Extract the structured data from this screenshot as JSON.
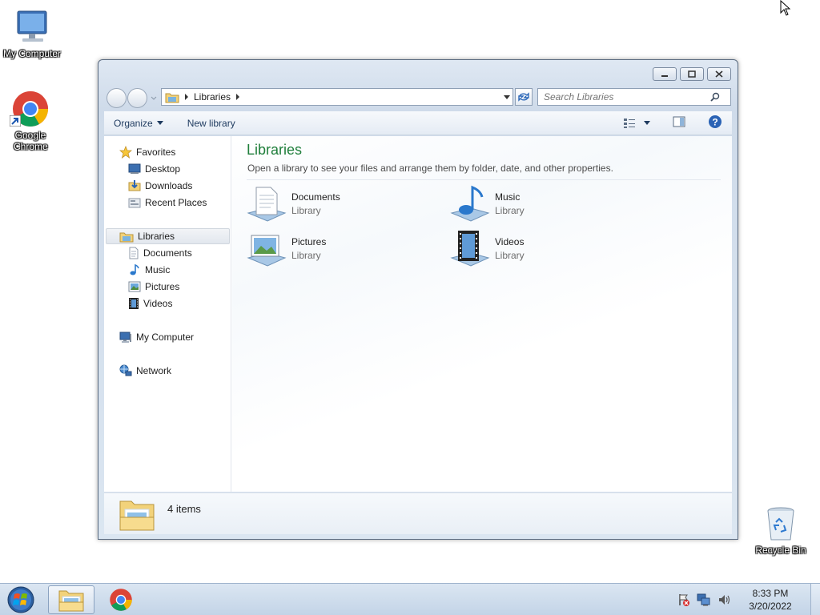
{
  "desktop": {
    "icons": [
      {
        "label": "My Computer"
      },
      {
        "label": "Google Chrome"
      },
      {
        "label": "Recycle Bin"
      }
    ]
  },
  "window": {
    "address": {
      "crumb": "Libraries"
    },
    "search": {
      "placeholder": "Search Libraries"
    },
    "toolbar": {
      "organize": "Organize",
      "new_library": "New library"
    },
    "nav": {
      "favorites": "Favorites",
      "desktop": "Desktop",
      "downloads": "Downloads",
      "recent_places": "Recent Places",
      "libraries": "Libraries",
      "documents": "Documents",
      "music": "Music",
      "pictures": "Pictures",
      "videos": "Videos",
      "my_computer": "My Computer",
      "network": "Network"
    },
    "main": {
      "title": "Libraries",
      "subtitle": "Open a library to see your files and arrange them by folder, date, and other properties.",
      "items": [
        {
          "name": "Documents",
          "type": "Library"
        },
        {
          "name": "Music",
          "type": "Library"
        },
        {
          "name": "Pictures",
          "type": "Library"
        },
        {
          "name": "Videos",
          "type": "Library"
        }
      ]
    },
    "details": {
      "count": "4 items"
    }
  },
  "taskbar": {
    "time": "8:33 PM",
    "date": "3/20/2022"
  },
  "colors": {
    "title_green": "#1e7e3a",
    "accent_blue": "#1e3a5f"
  }
}
